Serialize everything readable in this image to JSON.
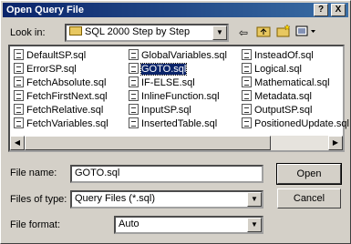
{
  "title": "Open Query File",
  "title_buttons": {
    "help": "?",
    "close": "X"
  },
  "look_in": {
    "label": "Look in:",
    "value": "SQL 2000 Step by Step"
  },
  "toolbar_icons": [
    "back-icon",
    "up-folder-icon",
    "new-folder-icon",
    "view-menu-icon"
  ],
  "files": [
    [
      "DefaultSP.sql",
      "ErrorSP.sql",
      "FetchAbsolute.sql",
      "FetchFirstNext.sql",
      "FetchRelative.sql",
      "FetchVariables.sql"
    ],
    [
      "GlobalVariables.sql",
      "GOTO.sql",
      "IF-ELSE.sql",
      "InlineFunction.sql",
      "InputSP.sql",
      "InsertedTable.sql"
    ],
    [
      "InsteadOf.sql",
      "Logical.sql",
      "Mathematical.sql",
      "Metadata.sql",
      "OutputSP.sql",
      "PositionedUpdate.sql"
    ]
  ],
  "selected_file": "GOTO.sql",
  "file_name": {
    "label": "File name:",
    "value": "GOTO.sql"
  },
  "files_of_type": {
    "label": "Files of type:",
    "value": "Query Files (*.sql)"
  },
  "file_format": {
    "label": "File format:",
    "value": "Auto"
  },
  "buttons": {
    "open": "Open",
    "cancel": "Cancel"
  }
}
